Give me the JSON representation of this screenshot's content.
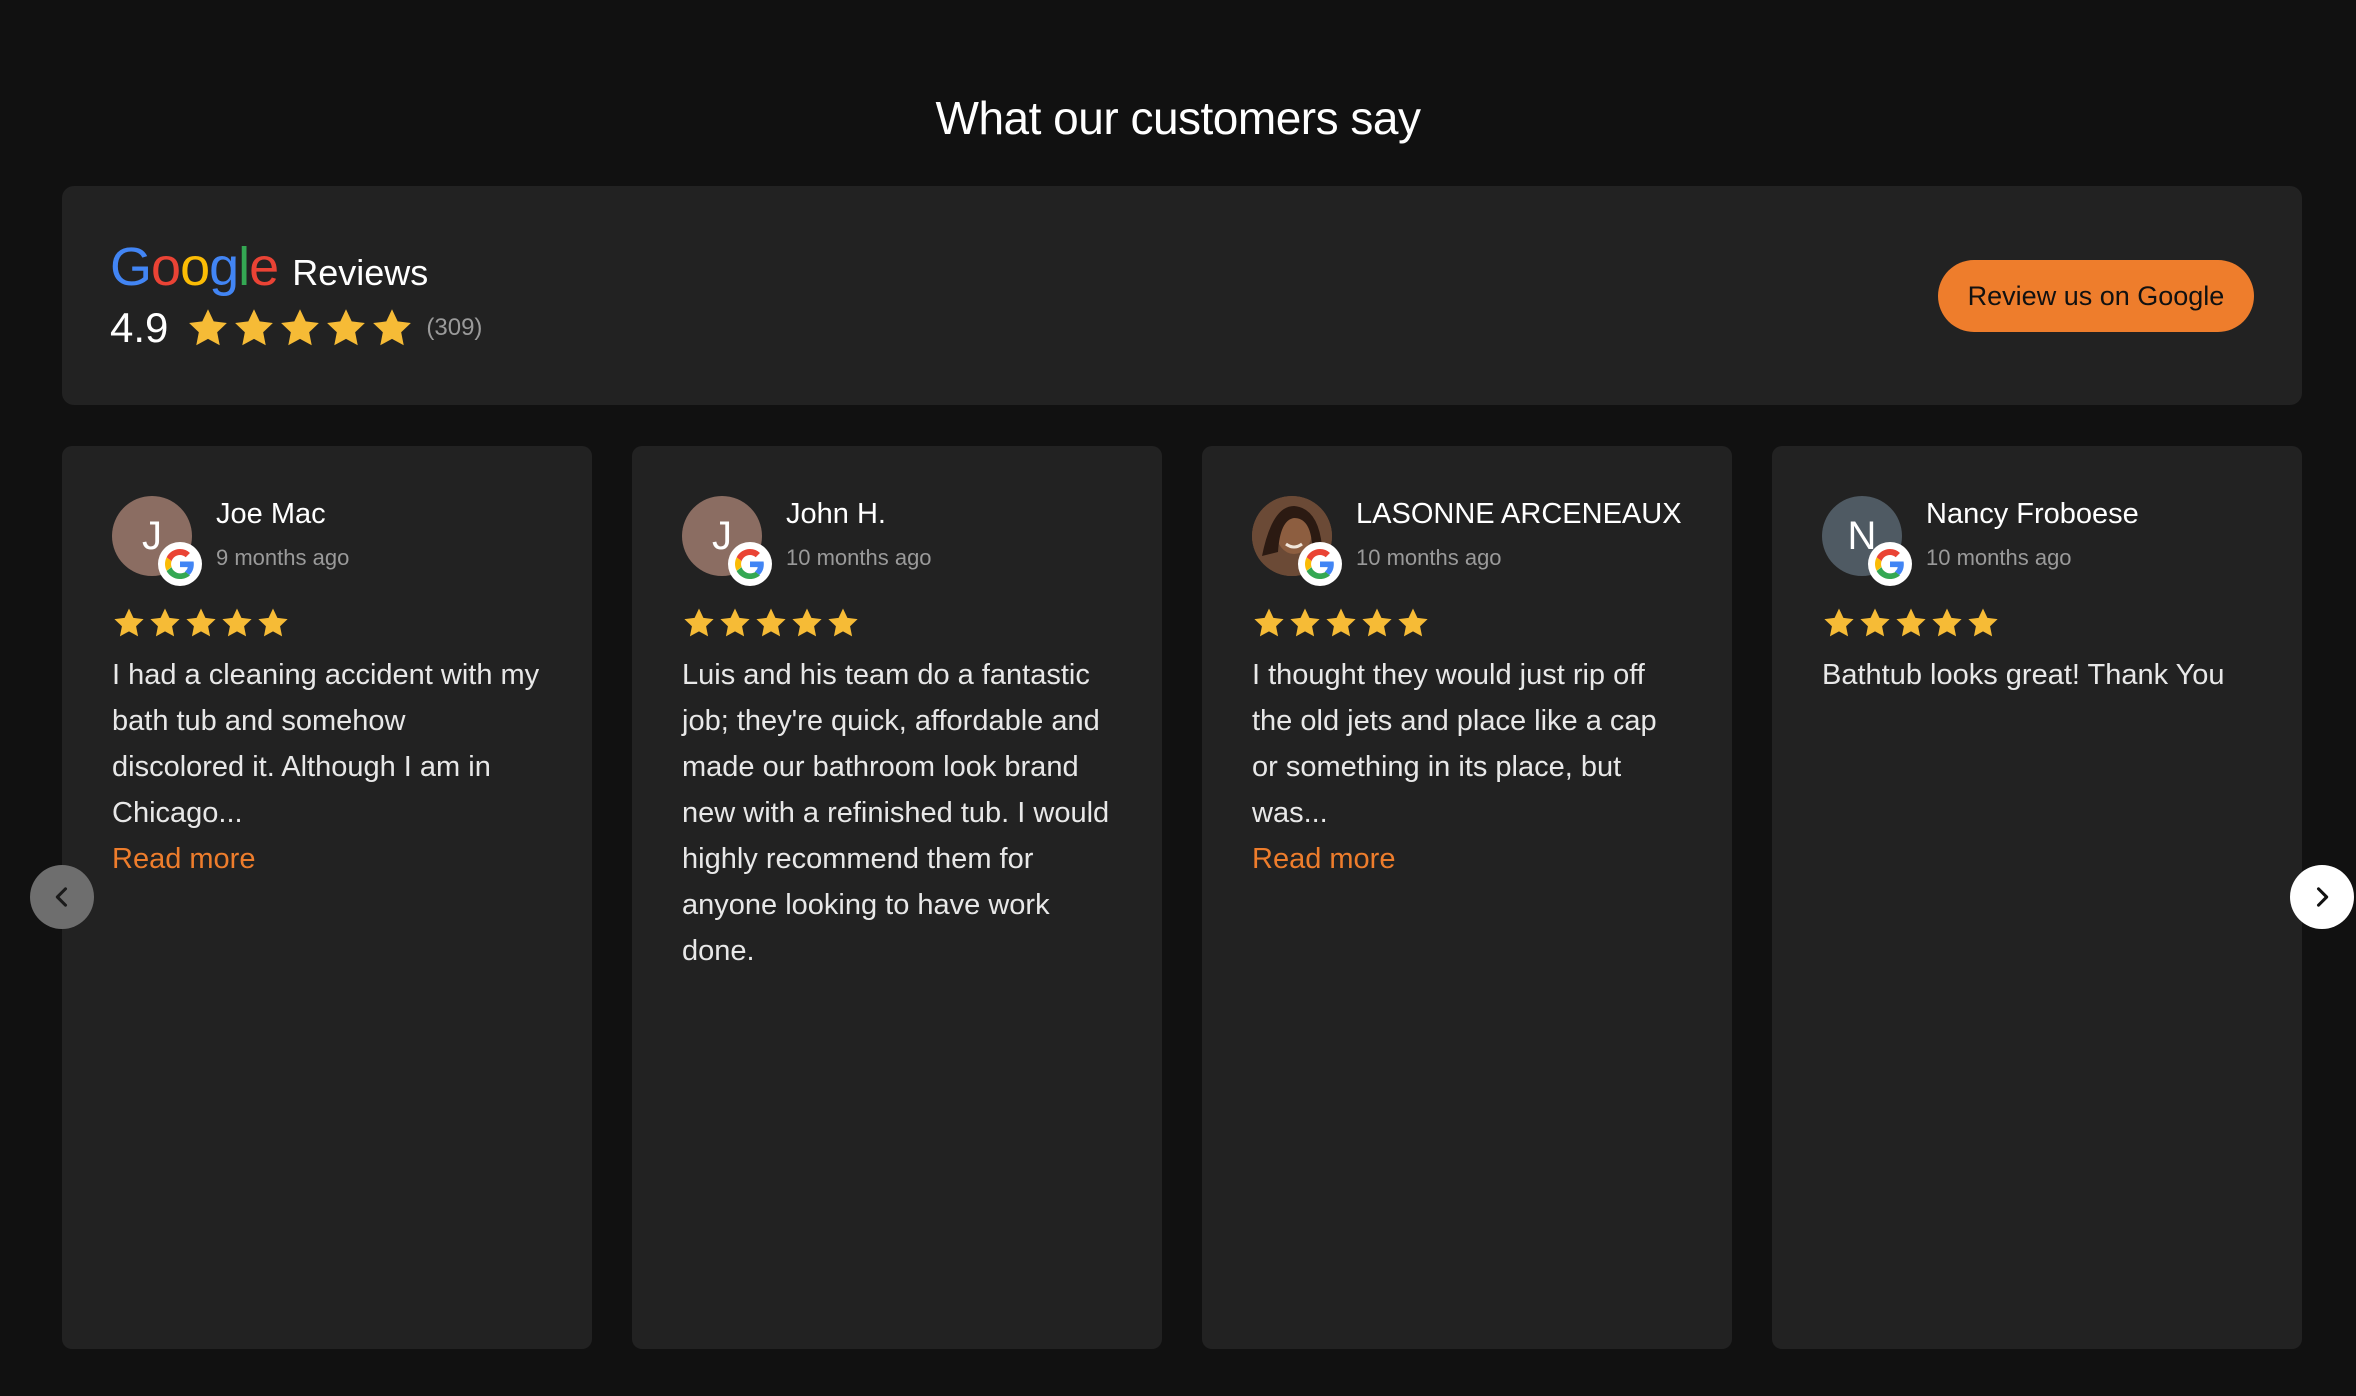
{
  "section": {
    "title": "What our customers say"
  },
  "summary": {
    "brand": "Google",
    "brand_suffix": "Reviews",
    "rating": "4.9",
    "count": "(309)",
    "cta_label": "Review us on Google",
    "stars": 5
  },
  "colors": {
    "background": "#111111",
    "card": "#222222",
    "accent": "#ee7d2c",
    "star": "#f6bb36"
  },
  "reviews": [
    {
      "initial": "J",
      "name": "Joe Mac",
      "date": "9 months ago",
      "stars": 5,
      "text": "I had a cleaning accident with my bath tub and somehow discolored it. Although I am in Chicago...",
      "read_more": "Read more",
      "avatar_color": "#8b6d62"
    },
    {
      "initial": "J",
      "name": "John H.",
      "date": "10 months ago",
      "stars": 5,
      "text": "Luis and his team do a fantastic job; they're quick, affordable and made our bathroom look brand new with a refinished tub. I would highly recommend them for anyone looking to have work done.",
      "avatar_color": "#8b6d62"
    },
    {
      "initial": "",
      "name": "LASONNE ARCENEAUX",
      "date": "10 months ago",
      "stars": 5,
      "text": "I thought they would just rip off the old jets and place like a cap or something in its place, but was...",
      "read_more": "Read more",
      "avatar_color": "#6b4a36"
    },
    {
      "initial": "N",
      "name": "Nancy Froboese",
      "date": "10 months ago",
      "stars": 5,
      "text": "Bathtub looks great! Thank You",
      "avatar_color": "#4f5a63"
    }
  ],
  "nav": {
    "prev_icon": "chevron-left-icon",
    "next_icon": "chevron-right-icon"
  }
}
